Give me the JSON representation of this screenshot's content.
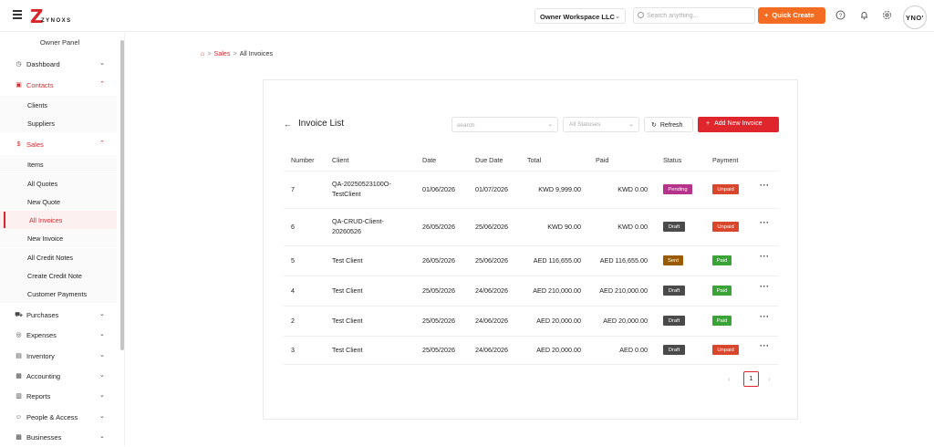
{
  "header": {
    "logo_text": "ZYNOXS",
    "workspace": "Owner Workspace LLC",
    "search_placeholder": "Search anything...",
    "quick_create_label": "Quick Create",
    "avatar_initials": "YNO'"
  },
  "sidebar": {
    "title": "Owner Panel",
    "items": [
      {
        "label": "Dashboard",
        "icon": "dashboard-icon",
        "open": false
      },
      {
        "label": "Contacts",
        "icon": "contacts-icon",
        "open": true,
        "children": [
          "Clients",
          "Suppliers"
        ]
      },
      {
        "label": "Sales",
        "icon": "sales-icon",
        "open": true,
        "children": [
          "Items",
          "All Quotes",
          "New Quote",
          "All Invoices",
          "New Invoice",
          "All Credit Notes",
          "Create Credit Note",
          "Customer Payments"
        ],
        "active_child": "All Invoices"
      },
      {
        "label": "Purchases",
        "icon": "purchases-icon",
        "open": false
      },
      {
        "label": "Expenses",
        "icon": "expenses-icon",
        "open": false
      },
      {
        "label": "Inventory",
        "icon": "inventory-icon",
        "open": false
      },
      {
        "label": "Accounting",
        "icon": "accounting-icon",
        "open": false
      },
      {
        "label": "Reports",
        "icon": "reports-icon",
        "open": false
      },
      {
        "label": "People & Access",
        "icon": "people-icon",
        "open": false
      },
      {
        "label": "Businesses",
        "icon": "businesses-icon",
        "open": false
      }
    ]
  },
  "breadcrumb": {
    "parent": "Sales",
    "current": "All Invoices"
  },
  "invoice_list": {
    "title": "Invoice List",
    "search_placeholder": "search",
    "status_filter": "All Statuses",
    "refresh_label": "Refresh",
    "add_label": "Add New Invoice",
    "columns": [
      "Number",
      "Client",
      "Date",
      "Due Date",
      "Total",
      "Paid",
      "Status",
      "Payment"
    ],
    "rows": [
      {
        "number": "7",
        "client_line1": "QA-20250523100O-",
        "client_line2": "TestClient",
        "date": "01/06/2026",
        "due": "01/07/2026",
        "total": "KWD 9,999.00",
        "paid": "KWD 0.00",
        "status": "Pending",
        "payment": "Unpaid"
      },
      {
        "number": "6",
        "client_line1": "QA-CRUD-Client-",
        "client_line2": "20260526",
        "date": "26/05/2026",
        "due": "25/06/2026",
        "total": "KWD 90.00",
        "paid": "KWD 0.00",
        "status": "Draft",
        "payment": "Unpaid"
      },
      {
        "number": "5",
        "client_line1": "Test Client",
        "client_line2": "",
        "date": "26/05/2026",
        "due": "25/06/2026",
        "total": "AED 116,655.00",
        "paid": "AED 116,655.00",
        "status": "Sent",
        "payment": "Paid"
      },
      {
        "number": "4",
        "client_line1": "Test Client",
        "client_line2": "",
        "date": "25/05/2026",
        "due": "24/06/2026",
        "total": "AED 210,000.00",
        "paid": "AED 210,000.00",
        "status": "Draft",
        "payment": "Paid"
      },
      {
        "number": "2",
        "client_line1": "Test Client",
        "client_line2": "",
        "date": "25/05/2026",
        "due": "24/06/2026",
        "total": "AED 20,000.00",
        "paid": "AED 20,000.00",
        "status": "Draft",
        "payment": "Paid"
      },
      {
        "number": "3",
        "client_line1": "Test Client",
        "client_line2": "",
        "date": "25/05/2026",
        "due": "24/06/2026",
        "total": "AED 20,000.00",
        "paid": "AED 0.00",
        "status": "Draft",
        "payment": "Unpaid"
      }
    ],
    "current_page": "1"
  },
  "colors": {
    "brand_red": "#d9262c",
    "quick_create_orange": "#f36c21",
    "status_pending": "#b5338a",
    "status_draft": "#4a4a4a",
    "status_sent": "#9a5b00",
    "payment_unpaid": "#d9462c",
    "payment_paid": "#3aa335"
  }
}
